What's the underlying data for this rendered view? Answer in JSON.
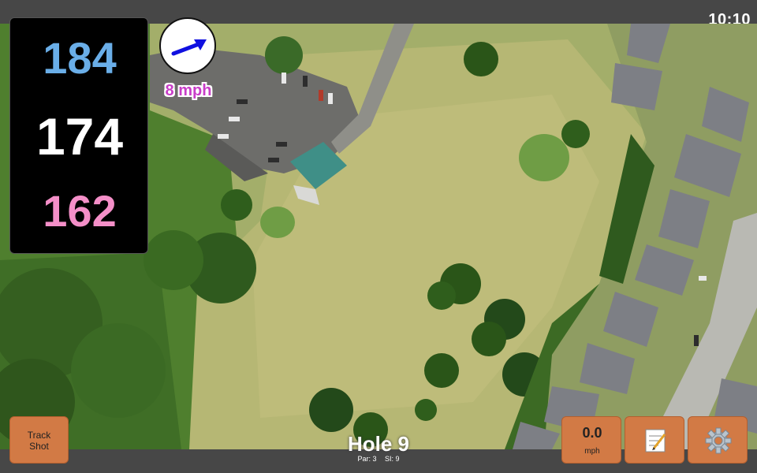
{
  "status": {
    "time": "10:10"
  },
  "distances": {
    "back": "184",
    "middle": "174",
    "front": "162"
  },
  "wind": {
    "speed_label": "8 mph",
    "direction_icon": "arrow-icon",
    "arrow_color": "#1010e0"
  },
  "buttons": {
    "track_shot": "Track Shot",
    "speed_value": "0.0",
    "speed_unit": "mph",
    "notes_icon": "notepad-icon",
    "settings_icon": "gear-icon"
  },
  "hole": {
    "title": "Hole 9",
    "par": "Par: 3",
    "si": "SI: 9"
  },
  "colors": {
    "back": "#6aaee8",
    "middle": "#ffffff",
    "front": "#f48fc8",
    "button": "#d27a45"
  }
}
